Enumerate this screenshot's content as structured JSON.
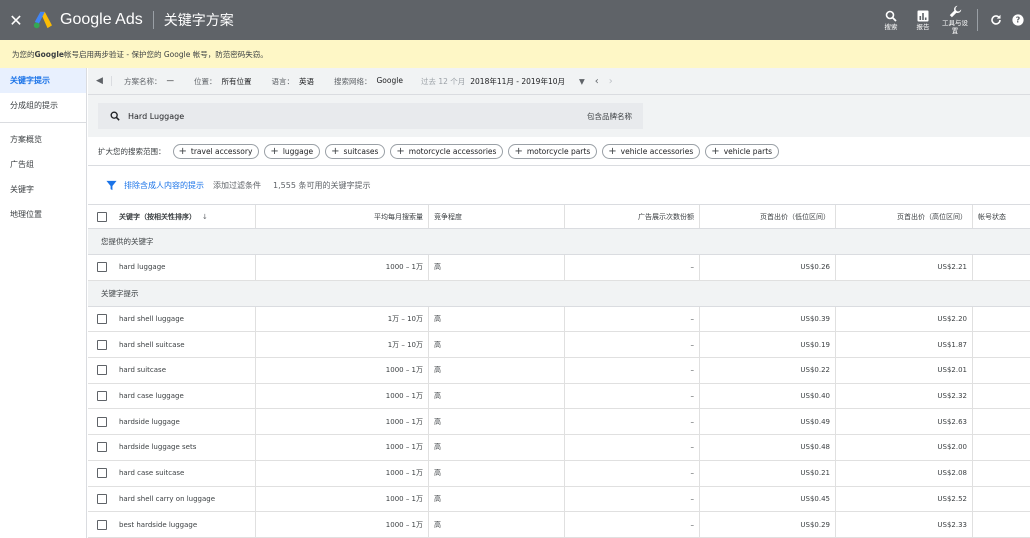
{
  "topbar": {
    "close": "✕",
    "brand": "Google Ads",
    "page_title": "关键字方案",
    "tools": [
      {
        "icon": "search-icon",
        "label": "搜索"
      },
      {
        "icon": "reports-icon",
        "label": "报告"
      },
      {
        "icon": "wrench-icon",
        "label": "工具与设置"
      }
    ]
  },
  "notice": {
    "text_prefix": "为您的 ",
    "text_bold": "Google",
    "text_suffix": " 帐号启用两步验证 - 保护您的 Google 帐号，防范密码失窃。"
  },
  "sidebar": {
    "items_top": [
      "关键字提示",
      "分成组的提示"
    ],
    "items_bottom": [
      "方案概览",
      "广告组",
      "关键字",
      "地理位置"
    ]
  },
  "filterbar": {
    "plan_name_label": "方案名称：",
    "plan_name_value": "—",
    "location_label": "位置：",
    "location_value": "所有位置",
    "language_label": "语言：",
    "language_value": "英语",
    "network_label": "搜索网络：",
    "network_value": "Google",
    "period_label": "过去 12 个月",
    "period_value": "2018年11月 - 2019年10月"
  },
  "search": {
    "query": "Hard Luggage",
    "brand_names": "包含品牌名称"
  },
  "expand": {
    "label": "扩大您的搜索范围：",
    "chips": [
      "travel accessory",
      "luggage",
      "suitcases",
      "motorcycle accessories",
      "motorcycle parts",
      "vehicle accessories",
      "vehicle parts"
    ]
  },
  "filters2": {
    "exclude_adult": "排除含成人内容的提示",
    "add_filter": "添加过滤条件",
    "available": "1,555 条可用的关键字提示"
  },
  "table": {
    "headers": [
      "关键字（按相关性排序）",
      "平均每月搜索量",
      "竞争程度",
      "广告展示次数份额",
      "页首出价（低位区间）",
      "页首出价（高位区间）",
      "帐号状态"
    ],
    "sort_arrow": "↓",
    "section_provided": "您提供的关键字",
    "section_ideas": "关键字提示",
    "provided": [
      {
        "kw": "hard luggage",
        "vol": "1000 – 1万",
        "comp": "高",
        "share": "–",
        "low": "US$0.26",
        "high": "US$2.21"
      }
    ],
    "ideas": [
      {
        "kw": "hard shell luggage",
        "vol": "1万 – 10万",
        "comp": "高",
        "share": "–",
        "low": "US$0.39",
        "high": "US$2.20"
      },
      {
        "kw": "hard shell suitcase",
        "vol": "1万 – 10万",
        "comp": "高",
        "share": "–",
        "low": "US$0.19",
        "high": "US$1.87"
      },
      {
        "kw": "hard suitcase",
        "vol": "1000 – 1万",
        "comp": "高",
        "share": "–",
        "low": "US$0.22",
        "high": "US$2.01"
      },
      {
        "kw": "hard case luggage",
        "vol": "1000 – 1万",
        "comp": "高",
        "share": "–",
        "low": "US$0.40",
        "high": "US$2.32"
      },
      {
        "kw": "hardside luggage",
        "vol": "1000 – 1万",
        "comp": "高",
        "share": "–",
        "low": "US$0.49",
        "high": "US$2.63"
      },
      {
        "kw": "hardside luggage sets",
        "vol": "1000 – 1万",
        "comp": "高",
        "share": "–",
        "low": "US$0.48",
        "high": "US$2.00"
      },
      {
        "kw": "hard case suitcase",
        "vol": "1000 – 1万",
        "comp": "高",
        "share": "–",
        "low": "US$0.21",
        "high": "US$2.08"
      },
      {
        "kw": "hard shell carry on luggage",
        "vol": "1000 – 1万",
        "comp": "高",
        "share": "–",
        "low": "US$0.45",
        "high": "US$2.52"
      },
      {
        "kw": "best hardside luggage",
        "vol": "1000 – 1万",
        "comp": "高",
        "share": "–",
        "low": "US$0.29",
        "high": "US$2.33"
      }
    ]
  },
  "colors": {
    "topbar": "#5f6368",
    "notice": "#fef7c6",
    "accent": "#1a73e8"
  }
}
